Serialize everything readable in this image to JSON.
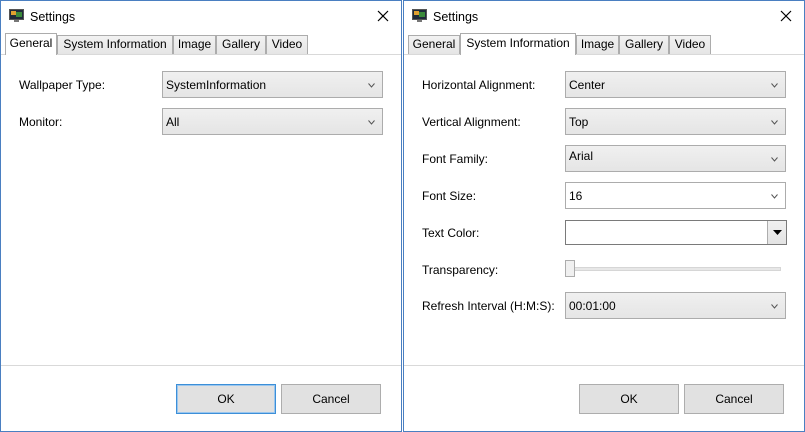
{
  "window_left": {
    "title": "Settings",
    "tabs": [
      "General",
      "System Information",
      "Image",
      "Gallery",
      "Video"
    ],
    "active_tab": "General",
    "fields": [
      {
        "label": "Wallpaper Type:",
        "value": "SystemInformation"
      },
      {
        "label": "Monitor:",
        "value": "All"
      }
    ],
    "ok_label": "OK",
    "cancel_label": "Cancel"
  },
  "window_right": {
    "title": "Settings",
    "tabs": [
      "General",
      "System Information",
      "Image",
      "Gallery",
      "Video"
    ],
    "active_tab": "System Information",
    "fields": [
      {
        "label": "Horizontal Alignment:",
        "value": "Center"
      },
      {
        "label": "Vertical Alignment:",
        "value": "Top"
      },
      {
        "label": "Font Family:",
        "value": "Arial"
      },
      {
        "label": "Font Size:",
        "value": "16"
      },
      {
        "label": "Text Color:",
        "value": ""
      },
      {
        "label": "Transparency:",
        "value": 0
      },
      {
        "label": "Refresh Interval (H:M:S):",
        "value": "00:01:00"
      }
    ],
    "ok_label": "OK",
    "cancel_label": "Cancel"
  },
  "colors": {
    "window_border": "#4a7fc1",
    "default_button_border": "#3c8fd8",
    "button_face": "#e1e1e1"
  },
  "icons": {
    "app": "monitor-app-icon",
    "close": "close-icon",
    "dropdown": "chevron-down-icon",
    "color_dropdown": "triangle-down-icon"
  }
}
